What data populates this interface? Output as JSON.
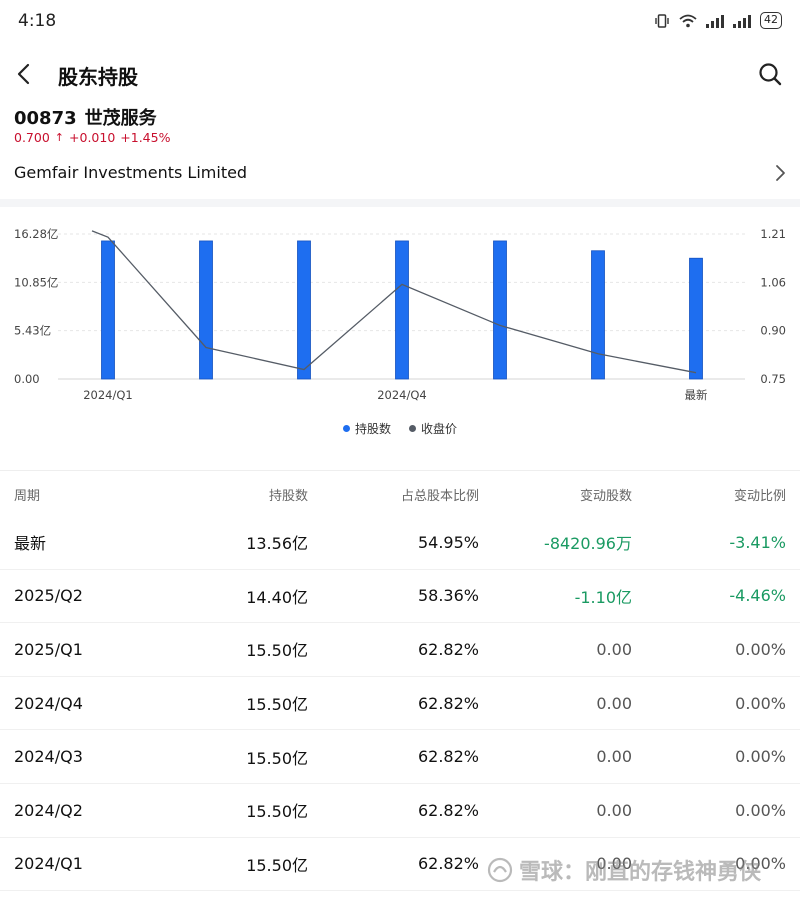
{
  "status_bar": {
    "time": "4:18",
    "battery": "42"
  },
  "header": {
    "title": "股东持股"
  },
  "stock": {
    "code": "00873",
    "name": "世茂服务",
    "price": "0.700",
    "change": "+0.010",
    "change_pct": "+1.45%"
  },
  "holder": {
    "name": "Gemfair Investments Limited"
  },
  "colors": {
    "up": "#c8102e",
    "down": "#1a9a62",
    "bar": "#1e6ef0",
    "line": "#555c66"
  },
  "chart_data": {
    "type": "bar",
    "categories": [
      "2024/Q1",
      "2024/Q2",
      "2024/Q3",
      "2024/Q4",
      "2025/Q1",
      "2025/Q2",
      "最新"
    ],
    "x_tick_labels": [
      "2024/Q1",
      "2024/Q4",
      "最新"
    ],
    "series": [
      {
        "name": "持股数",
        "type": "bar",
        "axis": "left",
        "values": [
          15.5,
          15.5,
          15.5,
          15.5,
          15.5,
          14.4,
          13.56
        ]
      },
      {
        "name": "收盘价",
        "type": "line",
        "axis": "right",
        "values": [
          1.2,
          0.85,
          0.78,
          1.05,
          0.92,
          0.83,
          0.77
        ],
        "start_value": 1.22
      }
    ],
    "y_left": {
      "ticks": [
        "0.00",
        "5.43亿",
        "10.85亿",
        "16.28亿"
      ],
      "ylim": [
        0,
        16.28
      ]
    },
    "y_right": {
      "ticks": [
        "0.75",
        "0.90",
        "1.06",
        "1.21"
      ],
      "ylim": [
        0.75,
        1.21
      ]
    },
    "grid": true,
    "legend_position": "bottom-center"
  },
  "table": {
    "headers": [
      "周期",
      "持股数",
      "占总股本比例",
      "变动股数",
      "变动比例"
    ],
    "rows": [
      {
        "period": "最新",
        "shares": "13.56亿",
        "ratio": "54.95%",
        "change_shares": "-8420.96万",
        "change_ratio": "-3.41%",
        "neg": true
      },
      {
        "period": "2025/Q2",
        "shares": "14.40亿",
        "ratio": "58.36%",
        "change_shares": "-1.10亿",
        "change_ratio": "-4.46%",
        "neg": true
      },
      {
        "period": "2025/Q1",
        "shares": "15.50亿",
        "ratio": "62.82%",
        "change_shares": "0.00",
        "change_ratio": "0.00%",
        "neg": false
      },
      {
        "period": "2024/Q4",
        "shares": "15.50亿",
        "ratio": "62.82%",
        "change_shares": "0.00",
        "change_ratio": "0.00%",
        "neg": false
      },
      {
        "period": "2024/Q3",
        "shares": "15.50亿",
        "ratio": "62.82%",
        "change_shares": "0.00",
        "change_ratio": "0.00%",
        "neg": false
      },
      {
        "period": "2024/Q2",
        "shares": "15.50亿",
        "ratio": "62.82%",
        "change_shares": "0.00",
        "change_ratio": "0.00%",
        "neg": false
      },
      {
        "period": "2024/Q1",
        "shares": "15.50亿",
        "ratio": "62.82%",
        "change_shares": "0.00",
        "change_ratio": "0.00%",
        "neg": false
      }
    ]
  },
  "watermark": {
    "text": "雪球：刚直的存钱神勇侠"
  }
}
